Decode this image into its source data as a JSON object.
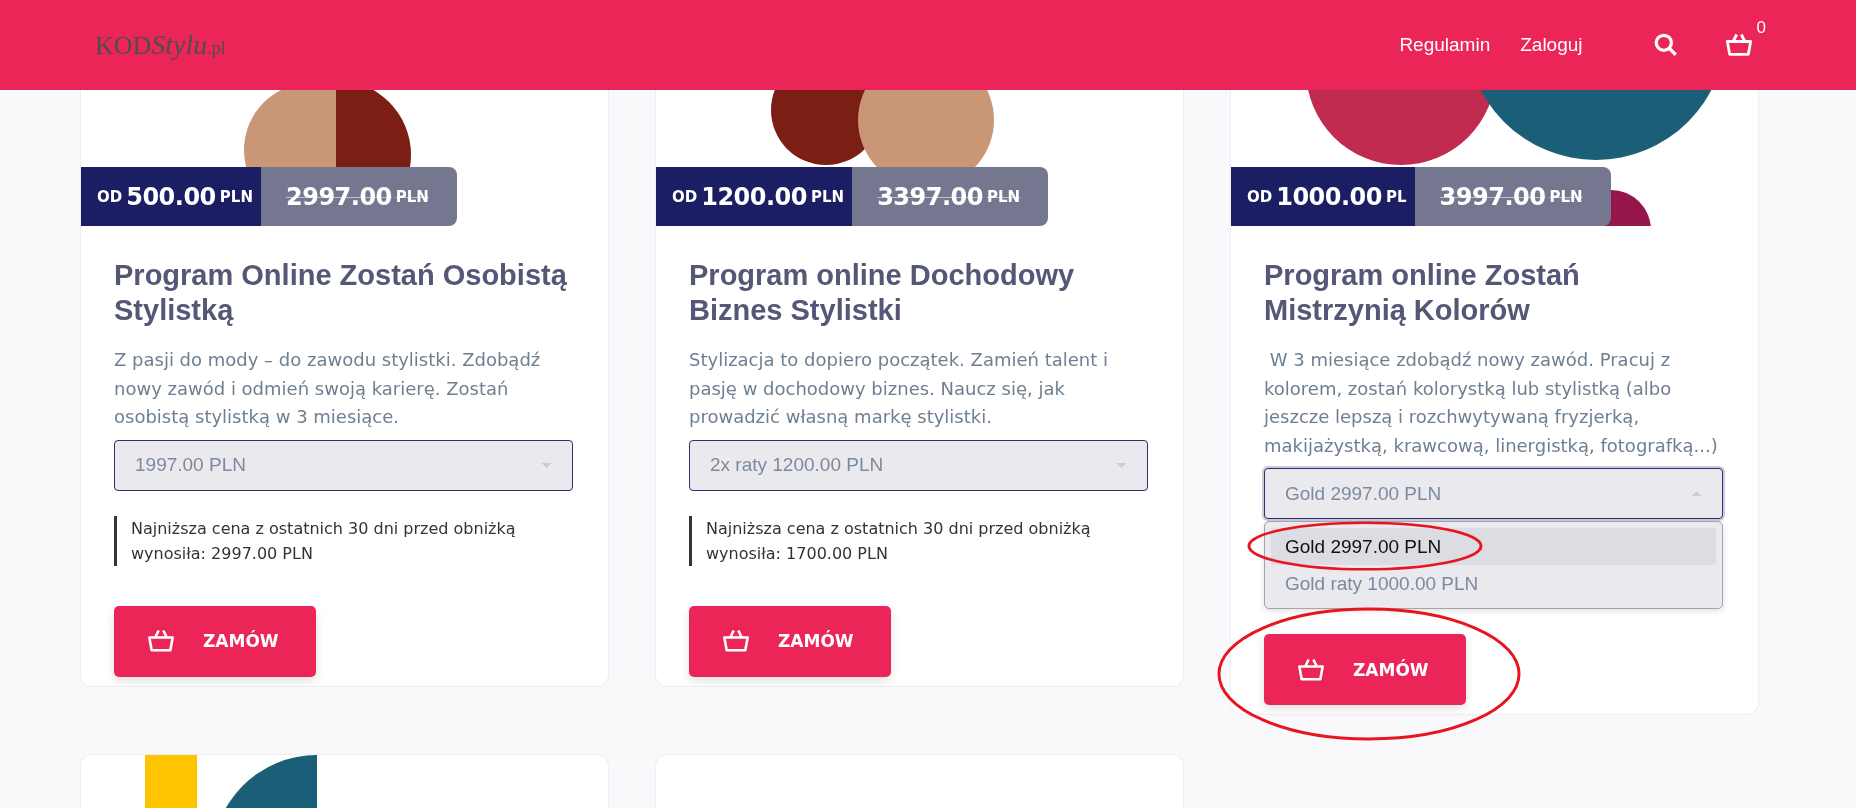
{
  "header": {
    "logo": {
      "main": "KOD",
      "script": "Stylu",
      "suffix": ".pl"
    },
    "nav": [
      "Regulamin",
      "Zaloguj"
    ],
    "cart_count": "0"
  },
  "products": [
    {
      "price_prefix": "OD",
      "price": "500.00",
      "price_currency": "PLN",
      "old_price": "2997.00",
      "old_currency": "PLN",
      "title": "Program Online Zostań Osobistą Stylistką",
      "description": "Z pasji do mody – do zawodu stylistki. Zdobądź nowy zawód i odmień swoją karierę. Zostań osobistą stylistką w 3 miesiące.",
      "select": {
        "value": "1997.00 PLN",
        "open": false
      },
      "note": "Najniższa cena z ostatnich 30 dni przed obniżką wynosiła: 2997.00 PLN",
      "order_button": "ZAMÓW",
      "circled": false
    },
    {
      "price_prefix": "OD",
      "price": "1200.00",
      "price_currency": "PLN",
      "old_price": "3397.00",
      "old_currency": "PLN",
      "title": "Program online Dochodowy Biznes Stylistki",
      "description": "Stylizacja to dopiero początek. Zamień talent i pasję w dochodowy biznes. Naucz się, jak prowadzić własną markę stylistki.",
      "select": {
        "value": "2x raty 1200.00 PLN",
        "open": false
      },
      "note": "Najniższa cena z ostatnich 30 dni przed obniżką wynosiła: 1700.00 PLN",
      "order_button": "ZAMÓW",
      "circled": false
    },
    {
      "price_prefix": "OD",
      "price": "1000.00",
      "price_currency": "PL",
      "old_price": "3997.00",
      "old_currency": "PLN",
      "title": "Program online Zostań Mistrzynią Kolorów",
      "description": " W 3 miesiące zdobądź nowy zawód. Pracuj z kolorem, zostań kolorystką lub stylistką (albo jeszcze lepszą i rozchwytywaną fryzjerką, makijażystką, krawcową, linergistką, fotografką...)",
      "select": {
        "value": "Gold 2997.00 PLN",
        "open": true,
        "options": [
          {
            "label": "Gold 2997.00 PLN",
            "selected": true,
            "circled": true
          },
          {
            "label": "Gold raty 1000.00 PLN",
            "selected": false,
            "circled": false
          }
        ]
      },
      "order_button": "ZAMÓW",
      "circled": true
    }
  ],
  "more_products": [
    {
      "kind": "picture"
    },
    {
      "kind": "empty"
    }
  ]
}
